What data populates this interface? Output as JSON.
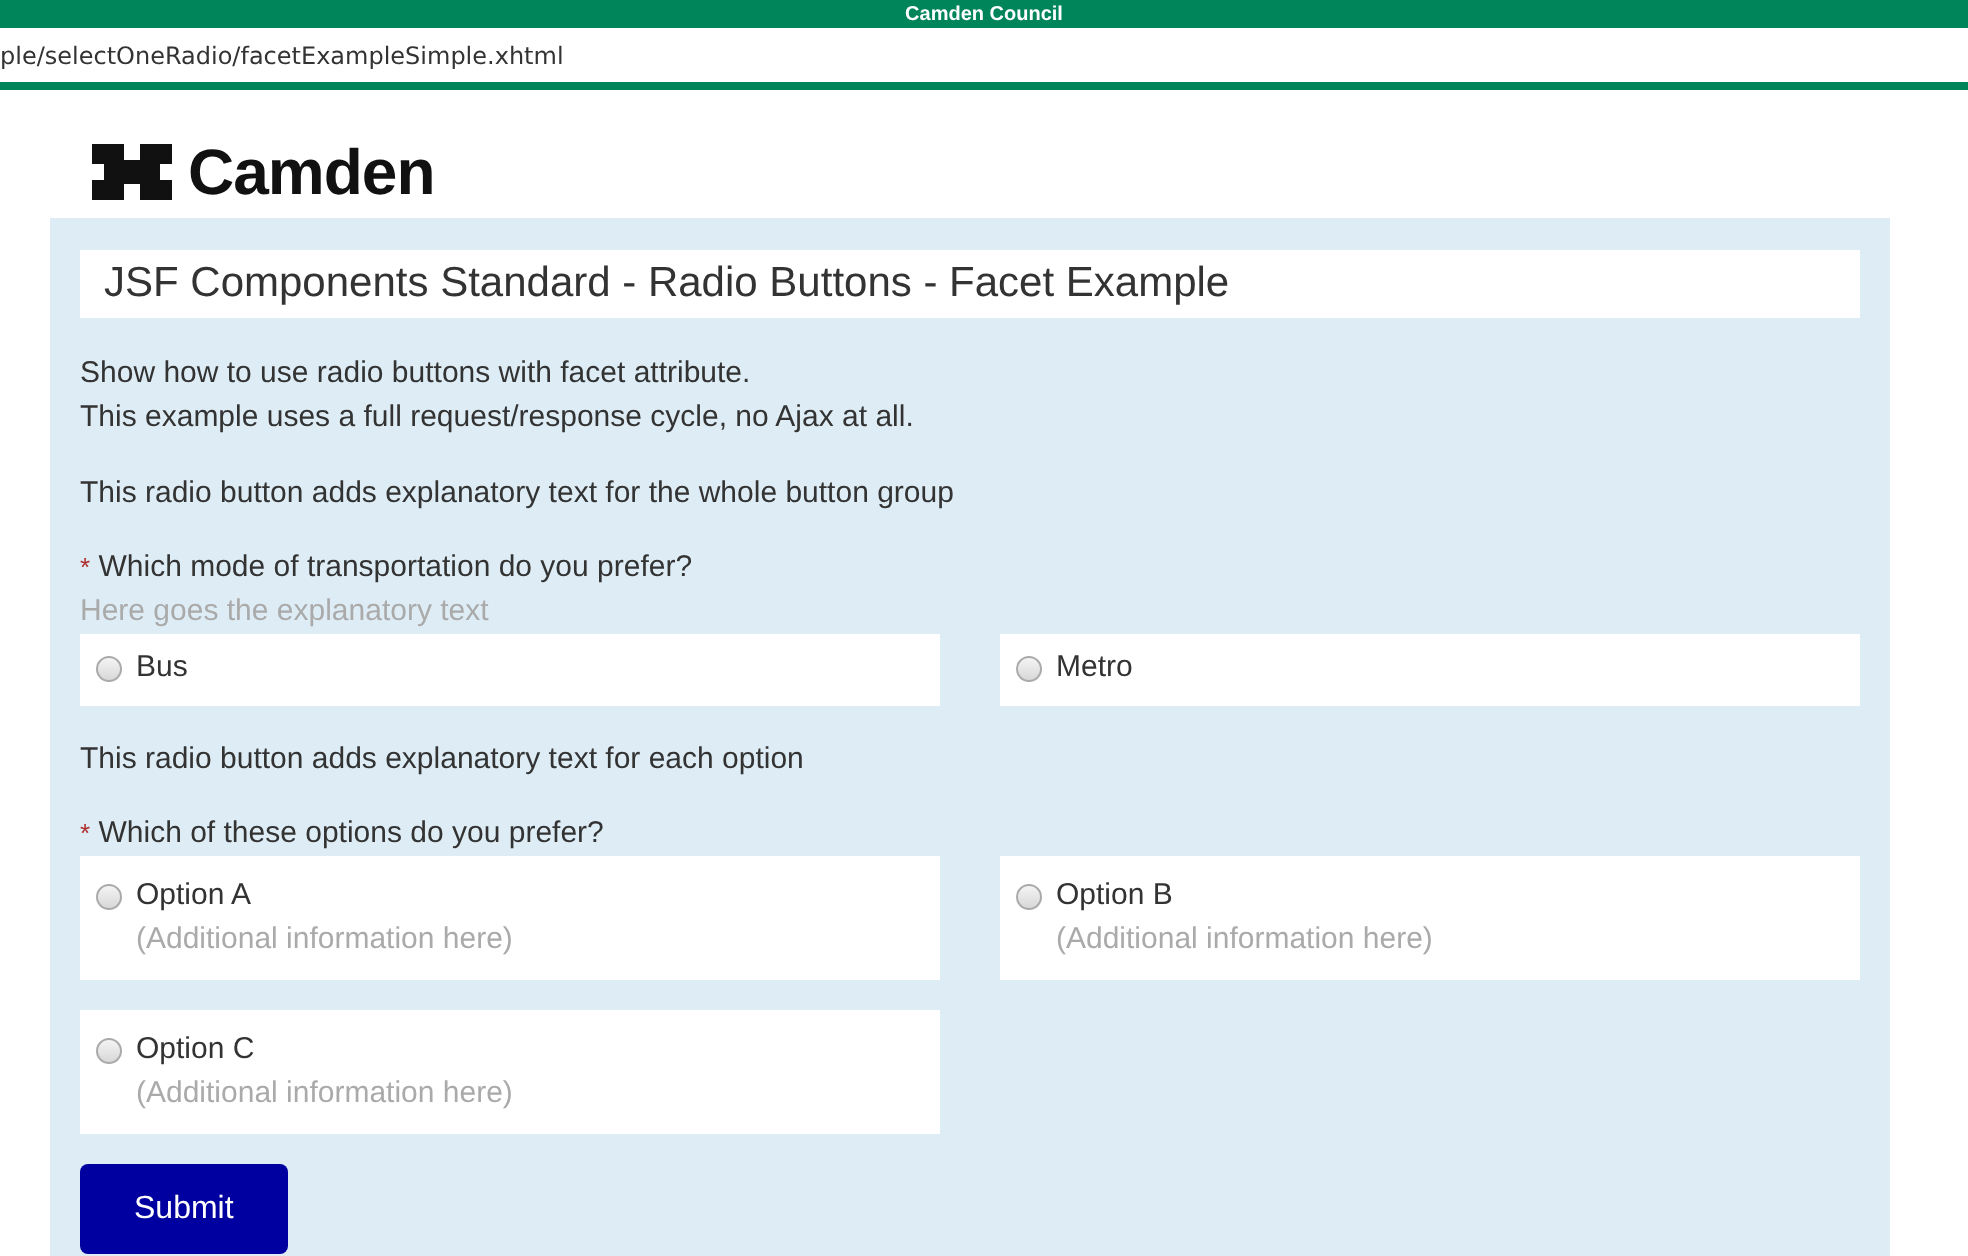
{
  "window": {
    "title": "Camden Council"
  },
  "address_bar": {
    "url": "ple/selectOneRadio/facetExampleSimple.xhtml"
  },
  "logo": {
    "text": "Camden"
  },
  "page_title": "JSF Components Standard - Radio Buttons - Facet Example",
  "intro": [
    "Show how to use radio buttons with facet attribute.",
    "This example uses a full request/response cycle, no Ajax at all."
  ],
  "groups": [
    {
      "caption": "This radio button adds explanatory text for the whole button group",
      "required_mark": "*",
      "question": "Which mode of transportation do you prefer?",
      "explanation": "Here goes the explanatory text",
      "options": [
        {
          "label": "Bus",
          "selected": false
        },
        {
          "label": "Metro",
          "selected": false
        }
      ]
    },
    {
      "caption": "This radio button adds explanatory text for each option",
      "required_mark": "*",
      "question": "Which of these options do you prefer?",
      "options": [
        {
          "label": "Option A",
          "detail": "(Additional information here)",
          "selected": false
        },
        {
          "label": "Option B",
          "detail": "(Additional information here)",
          "selected": false
        },
        {
          "label": "Option C",
          "detail": "(Additional information here)",
          "selected": false
        }
      ]
    }
  ],
  "submit": "Submit"
}
